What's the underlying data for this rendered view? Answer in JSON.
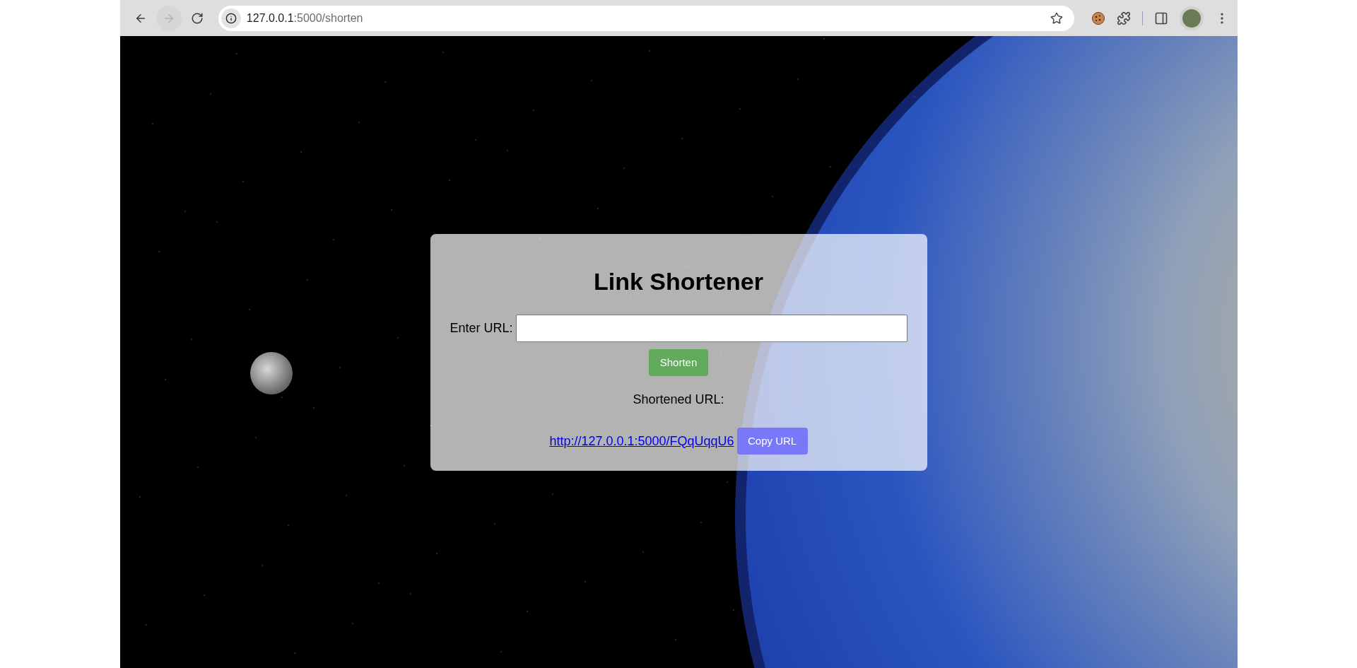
{
  "browser": {
    "nav_buttons": [
      {
        "kind": "back",
        "disabled": false
      },
      {
        "kind": "forward",
        "disabled": true
      },
      {
        "kind": "reload",
        "disabled": false
      }
    ],
    "address": {
      "host": "127.0.0.1",
      "path": ":5000/shorten"
    }
  },
  "form": {
    "title": "Link Shortener",
    "url_label": "Enter URL:",
    "submit_button": "Shorten",
    "result_label": "Shortened URL:",
    "short_url": "http://127.0.0.1:5000/FQqUqqU6",
    "copy_button": "Copy URL"
  }
}
